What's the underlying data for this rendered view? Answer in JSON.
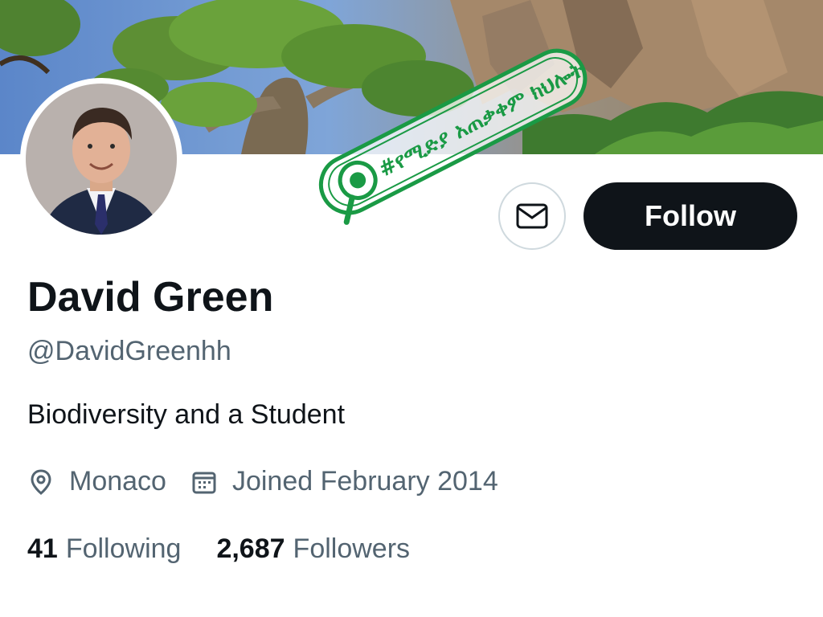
{
  "profile": {
    "name": "David Green",
    "handle": "@DavidGreenhh",
    "bio": "Biodiversity and a Student",
    "location": "Monaco",
    "joined": "Joined February 2014",
    "following_count": "41",
    "following_label": "Following",
    "followers_count": "2,687",
    "followers_label": "Followers"
  },
  "actions": {
    "follow_label": "Follow",
    "message_icon": "envelope-icon"
  },
  "overlay": {
    "stamp_text": "#የሚድያ አጠቃቀም ክህሎት",
    "stamp_color": "#1a9a45"
  },
  "icons": {
    "location": "location-pin-icon",
    "calendar": "calendar-icon"
  },
  "colors": {
    "primary_text": "#0f1419",
    "secondary_text": "#536471",
    "follow_bg": "#0f1419",
    "border": "#cfd9de"
  }
}
